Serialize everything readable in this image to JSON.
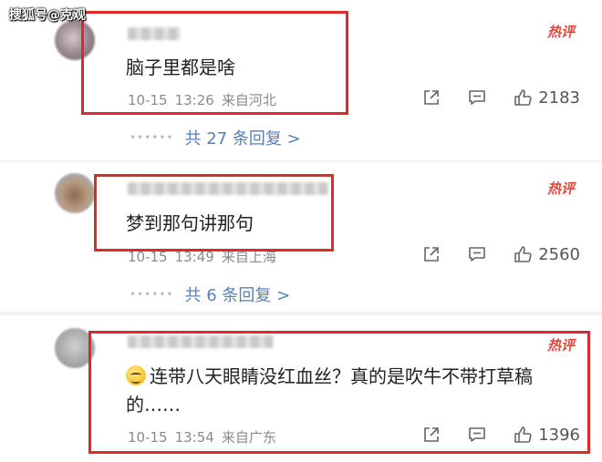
{
  "watermark": "搜狐号@克观",
  "hot_badge": "热评",
  "comments": [
    {
      "text": "脑子里都是啥",
      "date": "10-15",
      "time": "13:26",
      "location": "来自河北",
      "likes": "2183",
      "replies": "共 27 条回复 >"
    },
    {
      "text": "梦到那句讲那句",
      "date": "10-15",
      "time": "13:49",
      "location": "来自上海",
      "likes": "2560",
      "replies": "共 6 条回复 >"
    },
    {
      "text": "连带八天眼睛没红血丝？真的是吹牛不带打草稿的……",
      "date": "10-15",
      "time": "13:54",
      "location": "来自广东",
      "likes": "1396"
    }
  ],
  "icons": {
    "share": "share-icon",
    "comment": "comment-icon",
    "like": "like-icon",
    "emoji": "grin-emoji-icon"
  },
  "colors": {
    "highlight": "#e02a2a",
    "hot": "#e8463b",
    "reply_link": "#5b7fb5"
  }
}
